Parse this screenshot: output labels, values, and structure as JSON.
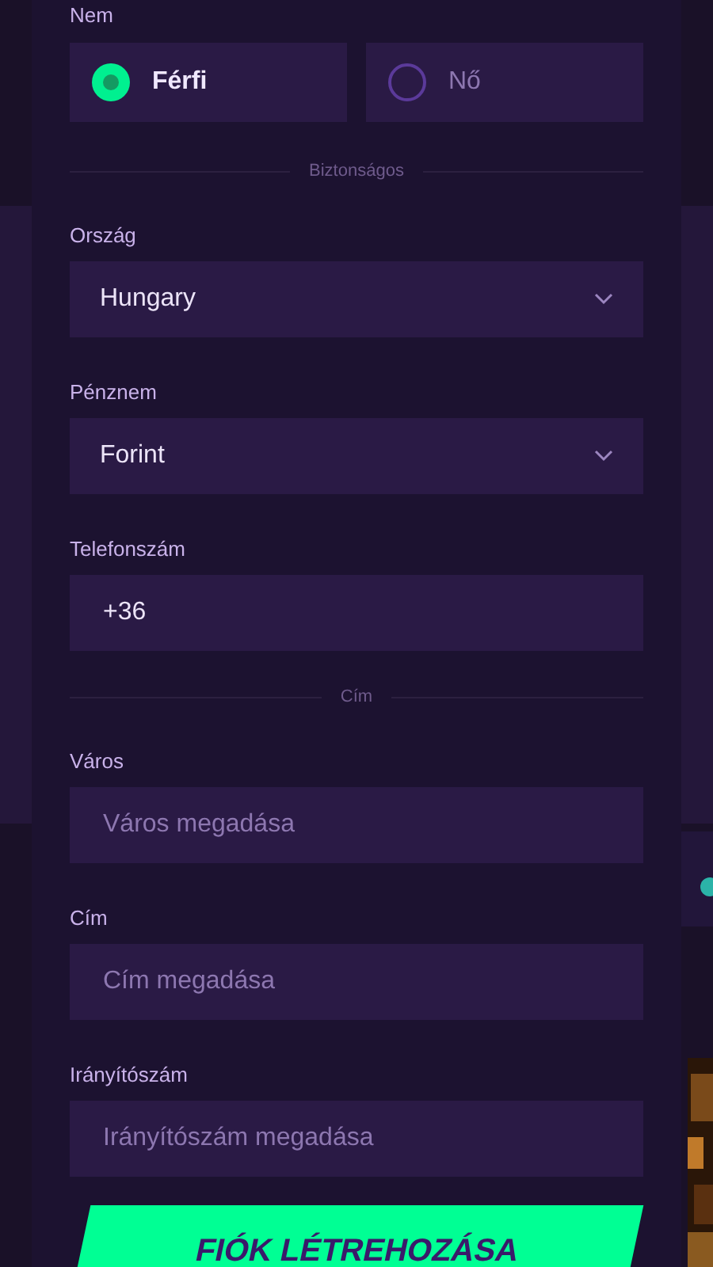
{
  "gender": {
    "label": "Nem",
    "options": [
      {
        "label": "Férfi",
        "selected": true
      },
      {
        "label": "Nő",
        "selected": false
      }
    ]
  },
  "sections": [
    {
      "divider": "Biztonságos",
      "fields": [
        {
          "kind": "select",
          "label": "Ország",
          "value": "Hungary"
        },
        {
          "kind": "select",
          "label": "Pénznem",
          "value": "Forint"
        },
        {
          "kind": "text",
          "label": "Telefonszám",
          "value": "+36"
        }
      ]
    },
    {
      "divider": "Cím",
      "fields": [
        {
          "kind": "text",
          "label": "Város",
          "placeholder": "Város megadása"
        },
        {
          "kind": "text",
          "label": "Cím",
          "placeholder": "Cím megadása"
        },
        {
          "kind": "text",
          "label": "Irányítószám",
          "placeholder": "Irányítószám megadása"
        }
      ]
    }
  ],
  "submit": "FIÓK LÉTREHOZÁSA"
}
